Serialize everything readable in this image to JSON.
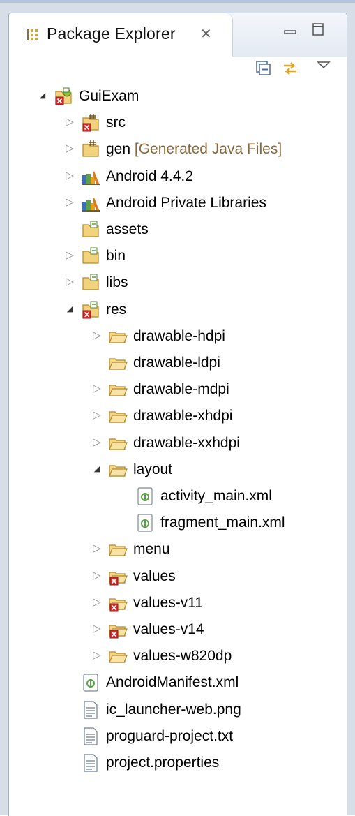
{
  "tab": {
    "title": "Package Explorer",
    "close_glyph": "✕"
  },
  "icons": {
    "tab": "package-explorer-icon",
    "minimize": "minimize-icon",
    "maximize": "maximize-icon",
    "collapse_all": "collapse-all-icon",
    "link_editor": "link-with-editor-icon",
    "view_menu": "view-menu-icon"
  },
  "tree": [
    {
      "name": "GuiExam",
      "dec": "",
      "depth": 0,
      "twisty": "expanded",
      "icon": "android-project-error-icon"
    },
    {
      "name": "src",
      "dec": "",
      "depth": 1,
      "twisty": "collapsed",
      "icon": "source-folder-error-icon"
    },
    {
      "name": "gen",
      "dec": "[Generated Java Files]",
      "depth": 1,
      "twisty": "collapsed",
      "icon": "source-folder-icon"
    },
    {
      "name": "Android 4.4.2",
      "dec": "",
      "depth": 1,
      "twisty": "collapsed",
      "icon": "library-icon"
    },
    {
      "name": "Android Private Libraries",
      "dec": "",
      "depth": 1,
      "twisty": "collapsed",
      "icon": "library-icon"
    },
    {
      "name": "assets",
      "dec": "",
      "depth": 1,
      "twisty": "none",
      "icon": "folder-icon"
    },
    {
      "name": "bin",
      "dec": "",
      "depth": 1,
      "twisty": "collapsed",
      "icon": "folder-icon"
    },
    {
      "name": "libs",
      "dec": "",
      "depth": 1,
      "twisty": "collapsed",
      "icon": "folder-icon"
    },
    {
      "name": "res",
      "dec": "",
      "depth": 1,
      "twisty": "expanded",
      "icon": "folder-error-icon"
    },
    {
      "name": "drawable-hdpi",
      "dec": "",
      "depth": 2,
      "twisty": "collapsed",
      "icon": "folder-open-icon"
    },
    {
      "name": "drawable-ldpi",
      "dec": "",
      "depth": 2,
      "twisty": "none",
      "icon": "folder-open-icon"
    },
    {
      "name": "drawable-mdpi",
      "dec": "",
      "depth": 2,
      "twisty": "collapsed",
      "icon": "folder-open-icon"
    },
    {
      "name": "drawable-xhdpi",
      "dec": "",
      "depth": 2,
      "twisty": "collapsed",
      "icon": "folder-open-icon"
    },
    {
      "name": "drawable-xxhdpi",
      "dec": "",
      "depth": 2,
      "twisty": "collapsed",
      "icon": "folder-open-icon"
    },
    {
      "name": "layout",
      "dec": "",
      "depth": 2,
      "twisty": "expanded",
      "icon": "folder-open-icon"
    },
    {
      "name": "activity_main.xml",
      "dec": "",
      "depth": 3,
      "twisty": "none",
      "icon": "android-xml-file-icon"
    },
    {
      "name": "fragment_main.xml",
      "dec": "",
      "depth": 3,
      "twisty": "none",
      "icon": "android-xml-file-icon"
    },
    {
      "name": "menu",
      "dec": "",
      "depth": 2,
      "twisty": "collapsed",
      "icon": "folder-open-icon"
    },
    {
      "name": "values",
      "dec": "",
      "depth": 2,
      "twisty": "collapsed",
      "icon": "folder-open-error-icon"
    },
    {
      "name": "values-v11",
      "dec": "",
      "depth": 2,
      "twisty": "collapsed",
      "icon": "folder-open-error-icon"
    },
    {
      "name": "values-v14",
      "dec": "",
      "depth": 2,
      "twisty": "collapsed",
      "icon": "folder-open-error-icon"
    },
    {
      "name": "values-w820dp",
      "dec": "",
      "depth": 2,
      "twisty": "collapsed",
      "icon": "folder-open-icon"
    },
    {
      "name": "AndroidManifest.xml",
      "dec": "",
      "depth": 1,
      "twisty": "none",
      "icon": "android-xml-file-icon"
    },
    {
      "name": "ic_launcher-web.png",
      "dec": "",
      "depth": 1,
      "twisty": "none",
      "icon": "file-icon"
    },
    {
      "name": "proguard-project.txt",
      "dec": "",
      "depth": 1,
      "twisty": "none",
      "icon": "file-icon"
    },
    {
      "name": "project.properties",
      "dec": "",
      "depth": 1,
      "twisty": "none",
      "icon": "file-icon"
    }
  ]
}
